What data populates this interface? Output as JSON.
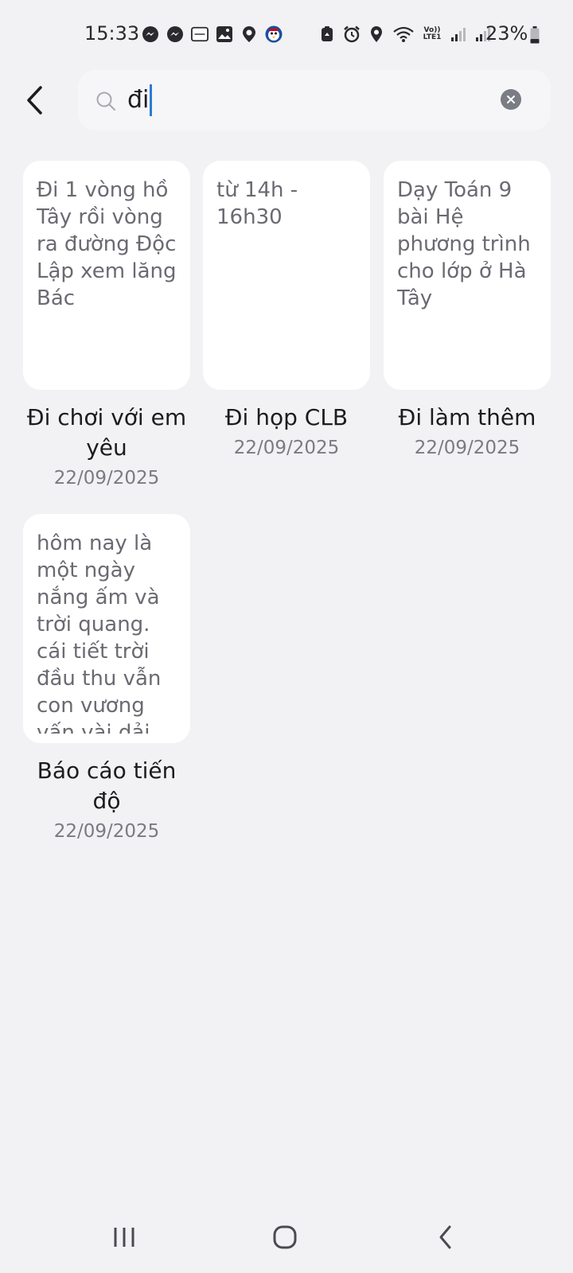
{
  "status_bar": {
    "time": "15:33",
    "battery": "23%",
    "network_label": "Vo)) LTE1",
    "left_icons": [
      "messenger-icon",
      "messenger-icon",
      "notes-app-icon",
      "gallery-icon",
      "location-icon",
      "penguin-app-icon"
    ],
    "right_icons": [
      "recycle-icon",
      "alarm-icon",
      "location-icon",
      "wifi-icon",
      "lte-icon",
      "signal-icon",
      "signal-icon"
    ]
  },
  "search": {
    "query": "đi",
    "icon": "search-icon",
    "clear_icon": "close-icon"
  },
  "notes": [
    {
      "preview": "Đi 1 vòng hồ Tây rồi vòng ra đường Độc Lập xem lăng Bác",
      "title": "Đi chơi với em yêu",
      "date": "22/09/2025"
    },
    {
      "preview": "từ 14h - 16h30",
      "title": "Đi họp CLB",
      "date": "22/09/2025"
    },
    {
      "preview": "Dạy Toán 9 bài Hệ phương trình cho lớp ở Hà Tây",
      "title": "Đi làm thêm",
      "date": "22/09/2025"
    },
    {
      "preview": "hôm nay là một ngày nắng ấm và trời quang. cái tiết trời đầu thu vẫn con vương vấn vài dải",
      "title": "Báo cáo tiến độ",
      "date": "22/09/2025"
    }
  ],
  "nav_bar": {
    "items": [
      "recent-apps-icon",
      "home-icon",
      "back-icon"
    ]
  },
  "colors": {
    "background": "#f2f2f4",
    "card": "#ffffff",
    "caret": "#2a7bd6",
    "muted_text": "#7a7a82"
  }
}
